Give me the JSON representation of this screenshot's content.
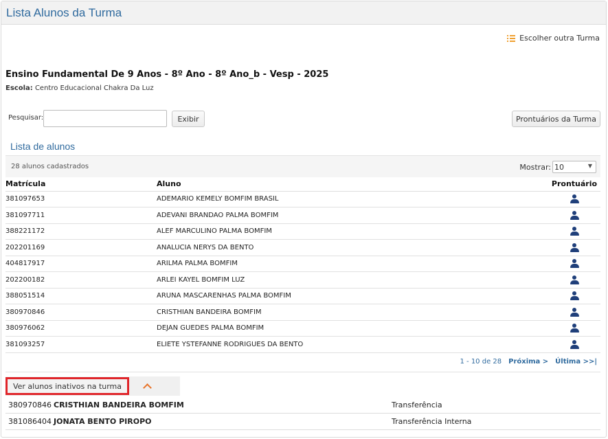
{
  "header": {
    "title": "Lista Alunos da Turma"
  },
  "switch_turma": {
    "label": "Escolher outra Turma",
    "icon": "list-icon"
  },
  "turma": {
    "title": "Ensino Fundamental De 9 Anos - 8º Ano - 8º Ano_b - Vesp - 2025",
    "escola_label": "Escola:",
    "escola_name": "Centro Educacional Chakra Da Luz"
  },
  "search": {
    "label": "Pesquisar:",
    "value": "",
    "placeholder": ""
  },
  "buttons": {
    "exibir": "Exibir",
    "prontuarios": "Prontuários da Turma"
  },
  "list": {
    "title": "Lista de alunos",
    "count": "28 alunos cadastrados",
    "mostrar_label": "Mostrar:",
    "mostrar_value": "10",
    "columns": {
      "matricula": "Matrícula",
      "aluno": "Aluno",
      "prontuario": "Prontuário"
    },
    "rows": [
      {
        "matricula": "381097653",
        "aluno": "ADEMARIO KEMELY BOMFIM BRASIL"
      },
      {
        "matricula": "381097711",
        "aluno": "ADEVANI BRANDAO PALMA BOMFIM"
      },
      {
        "matricula": "388221172",
        "aluno": "ALEF MARCULINO PALMA BOMFIM"
      },
      {
        "matricula": "202201169",
        "aluno": "ANALUCIA NERYS DA BENTO"
      },
      {
        "matricula": "404817917",
        "aluno": "ARILMA PALMA BOMFIM"
      },
      {
        "matricula": "202200182",
        "aluno": "ARLEI KAYEL BOMFIM LUZ"
      },
      {
        "matricula": "388051514",
        "aluno": "ARUNA MASCARENHAS PALMA BOMFIM"
      },
      {
        "matricula": "380970846",
        "aluno": "CRISTHIAN BANDEIRA BOMFIM"
      },
      {
        "matricula": "380976062",
        "aluno": "DEJAN GUEDES PALMA BOMFIM"
      },
      {
        "matricula": "381093257",
        "aluno": "ELIETE YSTEFANNE RODRIGUES DA BENTO"
      }
    ]
  },
  "pagination": {
    "range": "1 - 10 de 28",
    "next": "Próxima >",
    "last": "Última >>|"
  },
  "inactive": {
    "button_label": "Ver alunos inativos na turma",
    "rows": [
      {
        "matricula": "380970846",
        "nome": "CRISTHIAN BANDEIRA BOMFIM",
        "motivo": "Transferência"
      },
      {
        "matricula": "381086404",
        "nome": "JONATA BENTO PIROPO",
        "motivo": "Transferência Interna"
      }
    ]
  },
  "colors": {
    "title_blue": "#2f6a9e",
    "icon_navy": "#1f3f7a",
    "accent_orange": "#e8742a",
    "highlight_red": "#e0252a"
  }
}
